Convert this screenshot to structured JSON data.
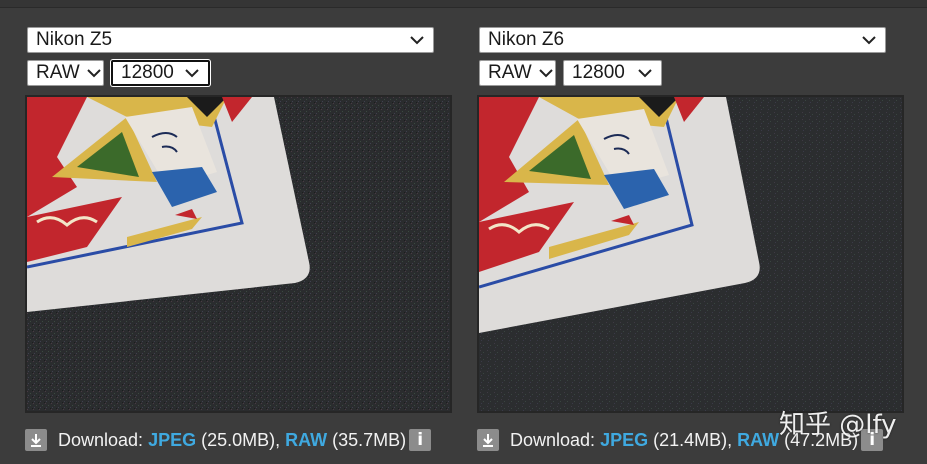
{
  "panes": [
    {
      "camera": "Nikon Z5",
      "mode": "RAW",
      "iso": "12800",
      "download": {
        "label": "Download:",
        "jpeg_label": "JPEG",
        "jpeg_size": "(25.0MB),",
        "raw_label": "RAW",
        "raw_size": "(35.7MB)"
      },
      "info_icon": "i"
    },
    {
      "camera": "Nikon Z6",
      "mode": "RAW",
      "iso": "12800",
      "download": {
        "label": "Download:",
        "jpeg_label": "JPEG",
        "jpeg_size": "(21.4MB),",
        "raw_label": "RAW",
        "raw_size": "(47.2MB)"
      },
      "info_icon": "i"
    }
  ],
  "watermark": "知乎 @lfy",
  "colors": {
    "background": "#3c3c3c",
    "link": "#3fa9e0",
    "dropdown_bg": "#ffffff",
    "icon_bg": "#8c8c8c"
  },
  "icons": [
    "chevron-down-icon",
    "download-icon",
    "info-icon"
  ]
}
